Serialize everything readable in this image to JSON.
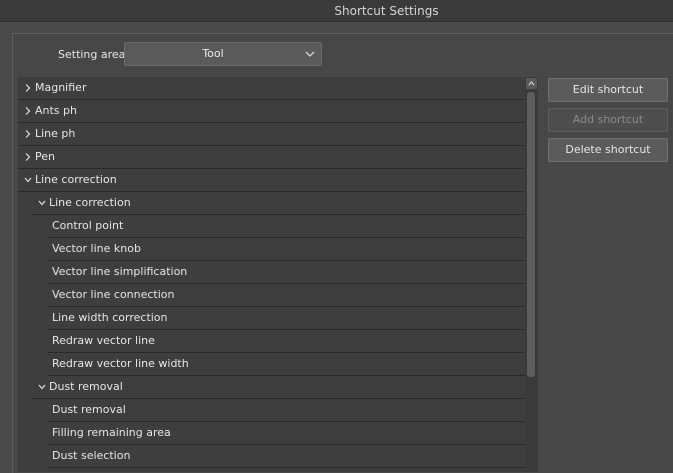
{
  "window": {
    "title": "Shortcut Settings"
  },
  "setting_area": {
    "label": "Setting area:",
    "selected": "Tool"
  },
  "buttons": {
    "edit": "Edit shortcut",
    "add": "Add shortcut",
    "delete": "Delete shortcut"
  },
  "tree": [
    {
      "label": "Magnifier",
      "level": 0,
      "state": "collapsed"
    },
    {
      "label": "Ants ph",
      "level": 0,
      "state": "collapsed"
    },
    {
      "label": "Line ph",
      "level": 0,
      "state": "collapsed"
    },
    {
      "label": "Pen",
      "level": 0,
      "state": "collapsed"
    },
    {
      "label": "Line correction",
      "level": 0,
      "state": "expanded"
    },
    {
      "label": "Line correction",
      "level": 1,
      "state": "expanded"
    },
    {
      "label": "Control point",
      "level": 2,
      "state": "leaf"
    },
    {
      "label": "Vector line knob",
      "level": 2,
      "state": "leaf"
    },
    {
      "label": "Vector line simplification",
      "level": 2,
      "state": "leaf"
    },
    {
      "label": "Vector line connection",
      "level": 2,
      "state": "leaf"
    },
    {
      "label": "Line width correction",
      "level": 2,
      "state": "leaf"
    },
    {
      "label": "Redraw vector line",
      "level": 2,
      "state": "leaf"
    },
    {
      "label": "Redraw vector line width",
      "level": 2,
      "state": "leaf"
    },
    {
      "label": "Dust removal",
      "level": 1,
      "state": "expanded"
    },
    {
      "label": "Dust removal",
      "level": 2,
      "state": "leaf"
    },
    {
      "label": "Filling remaining area",
      "level": 2,
      "state": "leaf"
    },
    {
      "label": "Dust selection",
      "level": 2,
      "state": "leaf"
    }
  ]
}
